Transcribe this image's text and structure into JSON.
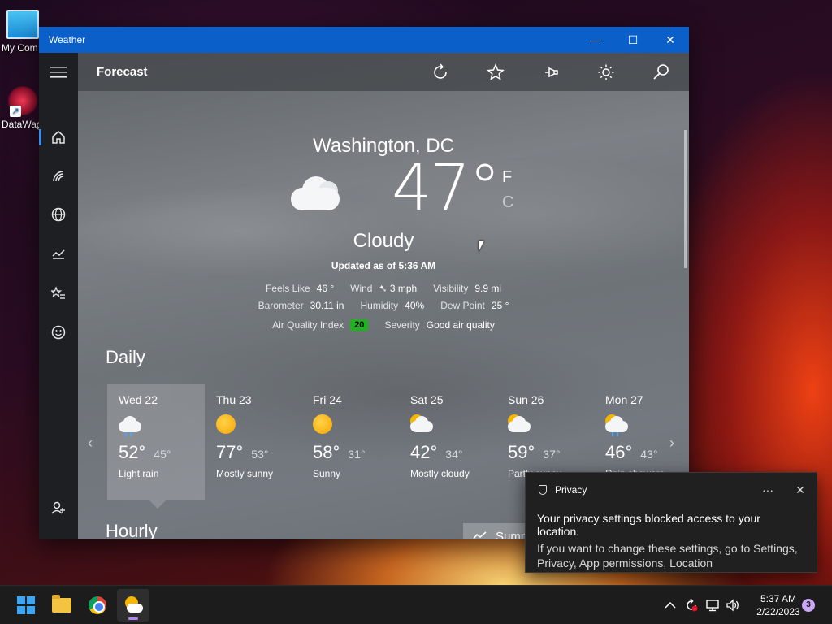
{
  "desktop": {
    "icons": [
      {
        "label": "My Com"
      },
      {
        "label": "DataWag"
      }
    ]
  },
  "window": {
    "title": "Weather",
    "controls": {
      "minimize": "—",
      "maximize": "☐",
      "close": "✕"
    }
  },
  "sidebar": {
    "icons": [
      "hamburger-icon",
      "home-icon",
      "radar-icon",
      "globe-icon",
      "chart-icon",
      "favorites-icon",
      "smiley-icon",
      "add-user-icon",
      "settings-icon"
    ]
  },
  "toolbar": {
    "page_title": "Forecast"
  },
  "current": {
    "city": "Washington, DC",
    "temp": "47°",
    "unit_f": "F",
    "unit_c": "C",
    "condition": "Cloudy",
    "updated": "Updated as of 5:36 AM"
  },
  "details": {
    "feels_like_label": "Feels Like",
    "feels_like": "46 °",
    "wind_label": "Wind",
    "wind": "➷ 3 mph",
    "visibility_label": "Visibility",
    "visibility": "9.9 mi",
    "barometer_label": "Barometer",
    "barometer": "30.11 in",
    "humidity_label": "Humidity",
    "humidity": "40%",
    "dew_point_label": "Dew Point",
    "dew_point": "25 °",
    "aqi_label": "Air Quality Index",
    "aqi": "20",
    "severity_label": "Severity",
    "severity": "Good air quality"
  },
  "daily": {
    "title": "Daily",
    "days": [
      {
        "name": "Wed 22",
        "hi": "52°",
        "lo": "45°",
        "cond": "Light rain",
        "icon": "rain-cloud-icon"
      },
      {
        "name": "Thu 23",
        "hi": "77°",
        "lo": "53°",
        "cond": "Mostly sunny",
        "icon": "sun-icon"
      },
      {
        "name": "Fri 24",
        "hi": "58°",
        "lo": "31°",
        "cond": "Sunny",
        "icon": "sun-icon"
      },
      {
        "name": "Sat 25",
        "hi": "42°",
        "lo": "34°",
        "cond": "Mostly cloudy",
        "icon": "cloud-sun-icon"
      },
      {
        "name": "Sun 26",
        "hi": "59°",
        "lo": "37°",
        "cond": "Partly sunny",
        "icon": "cloud-sun-icon"
      },
      {
        "name": "Mon 27",
        "hi": "46°",
        "lo": "43°",
        "cond": "Rain showers",
        "icon": "rain-sun-icon"
      }
    ]
  },
  "hourly": {
    "title": "Hourly",
    "summary_label": "Summ"
  },
  "toast": {
    "app_name": "Privacy",
    "more": "···",
    "close": "✕",
    "message": "Your privacy settings blocked access to your location.",
    "detail": "If you want to change these settings, go to Settings, Privacy, App permissions, Location"
  },
  "taskbar": {
    "time": "5:37 AM",
    "date": "2/22/2023",
    "notifications": "3"
  }
}
